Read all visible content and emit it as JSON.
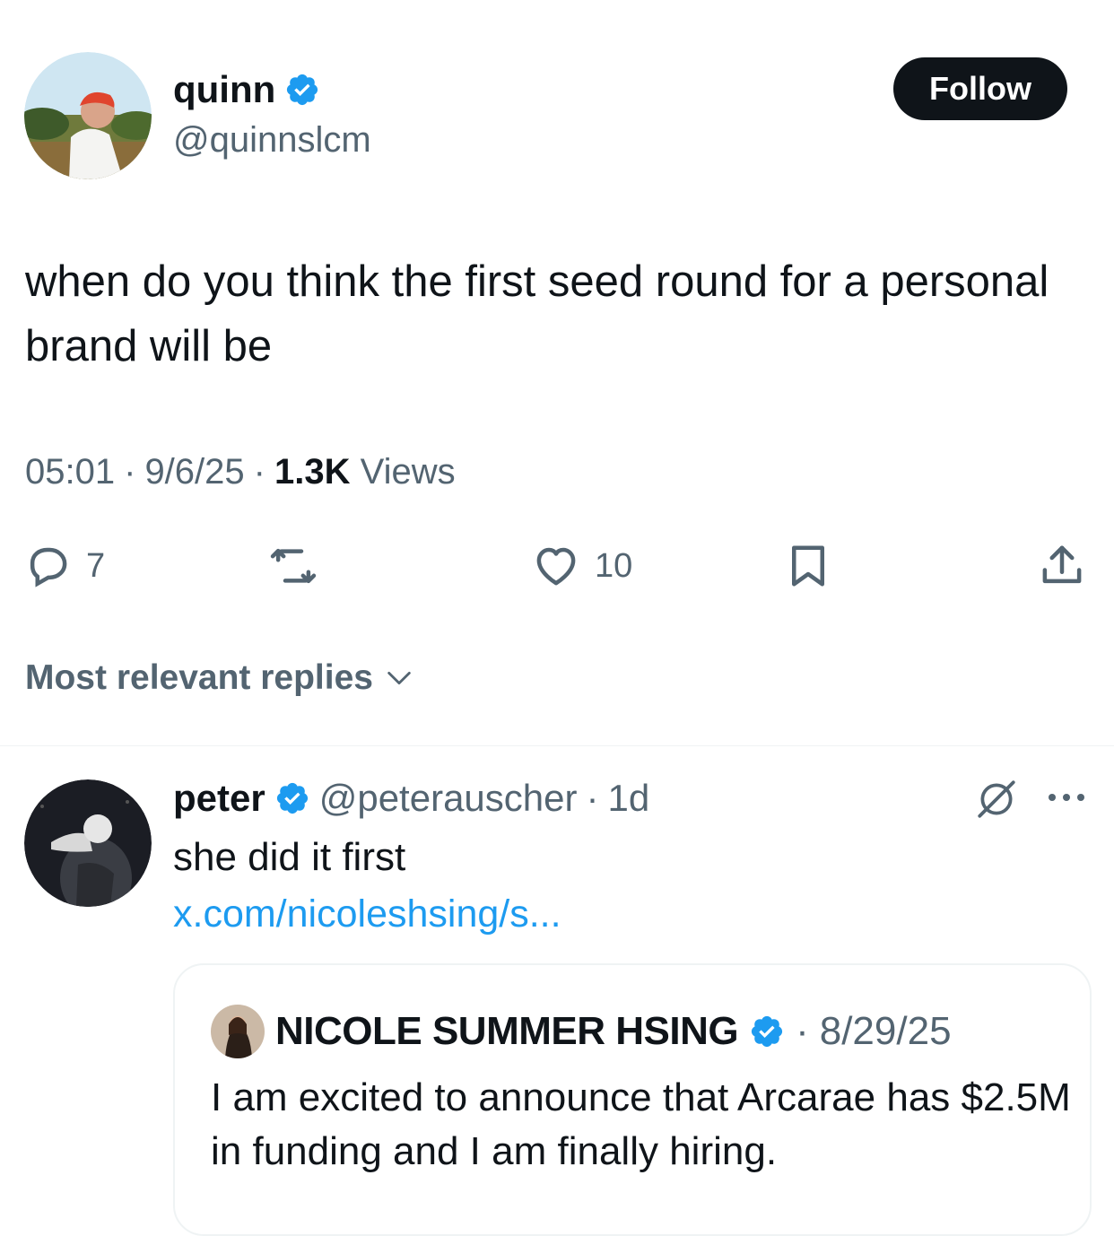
{
  "author": {
    "name": "quinn",
    "handle": "@quinnslcm",
    "follow_label": "Follow"
  },
  "tweet": {
    "text": "when do you think the first seed round for a personal brand will be",
    "time": "05:01",
    "date": "9/6/25",
    "views_count": "1.3K",
    "views_label": "Views",
    "sep": "·"
  },
  "actions": {
    "replies": "7",
    "retweets": "",
    "likes": "10"
  },
  "sort": {
    "label": "Most relevant replies"
  },
  "reply": {
    "name": "peter",
    "handle": "@peterauscher",
    "age": "1d",
    "sep": "·",
    "text": "she did it first",
    "link": "x.com/nicoleshsing/s..."
  },
  "quote": {
    "name": "NICOLE SUMMER HSING",
    "date": "8/29/25",
    "sep": "·",
    "text": "I am excited to announce that Arcarae has $2.5M in funding and I am finally hiring."
  },
  "colors": {
    "verified": "#1d9bf0",
    "link": "#1d9bf0",
    "secondary": "#536471",
    "primary": "#0f1419"
  },
  "icons": [
    "verified-badge-icon",
    "reply-icon",
    "retweet-icon",
    "like-icon",
    "bookmark-icon",
    "share-icon",
    "chevron-down-icon",
    "grok-icon",
    "more-icon"
  ]
}
